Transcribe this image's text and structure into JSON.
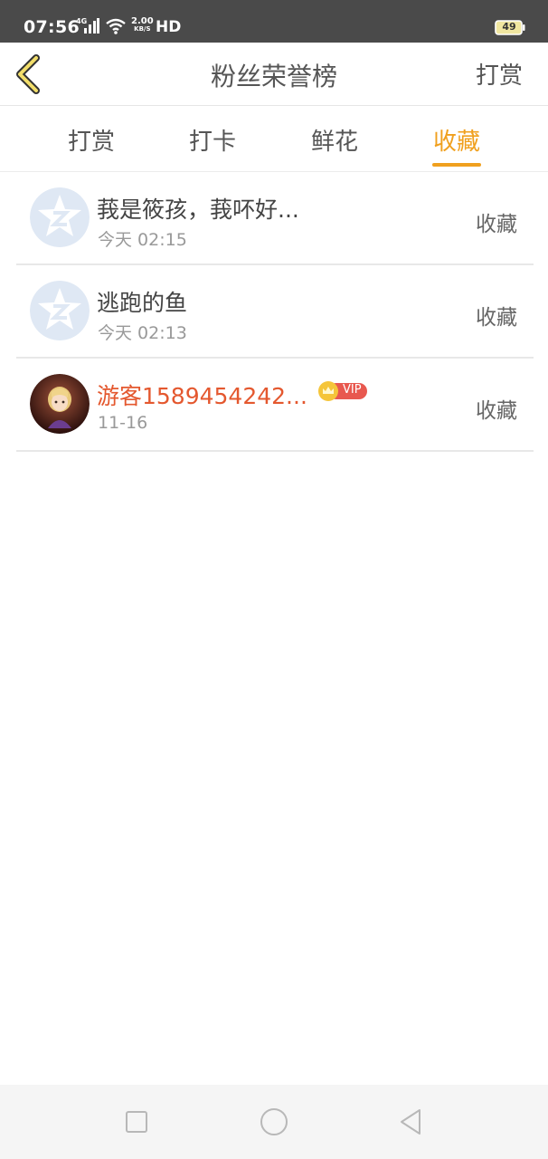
{
  "status_bar": {
    "time": "07:56",
    "network": "4G",
    "speed_value": "2.00",
    "speed_unit": "KB/S",
    "hd": "HD",
    "battery": "49"
  },
  "header": {
    "title": "粉丝荣誉榜",
    "action_label": "打赏",
    "back_icon": "chevron-left-icon"
  },
  "tabs": [
    {
      "label": "打赏",
      "active": false
    },
    {
      "label": "打卡",
      "active": false
    },
    {
      "label": "鲜花",
      "active": false
    },
    {
      "label": "收藏",
      "active": true
    }
  ],
  "list": [
    {
      "name": "莪是筱孩，莪吥好...",
      "time": "今天 02:15",
      "action": "收藏",
      "avatar": "default-avatar-icon",
      "vip": false
    },
    {
      "name": "逃跑的鱼",
      "time": "今天 02:13",
      "action": "收藏",
      "avatar": "default-avatar-icon",
      "vip": false
    },
    {
      "name": "游客1589454242...",
      "time": "11-16",
      "action": "收藏",
      "avatar": "user-photo",
      "vip": true,
      "vip_label": "VIP"
    }
  ],
  "colors": {
    "accent": "#f0a01e",
    "vip_name": "#e4582f",
    "vip_badge": "#e8584f",
    "status_bar": "#4a4a4a"
  }
}
